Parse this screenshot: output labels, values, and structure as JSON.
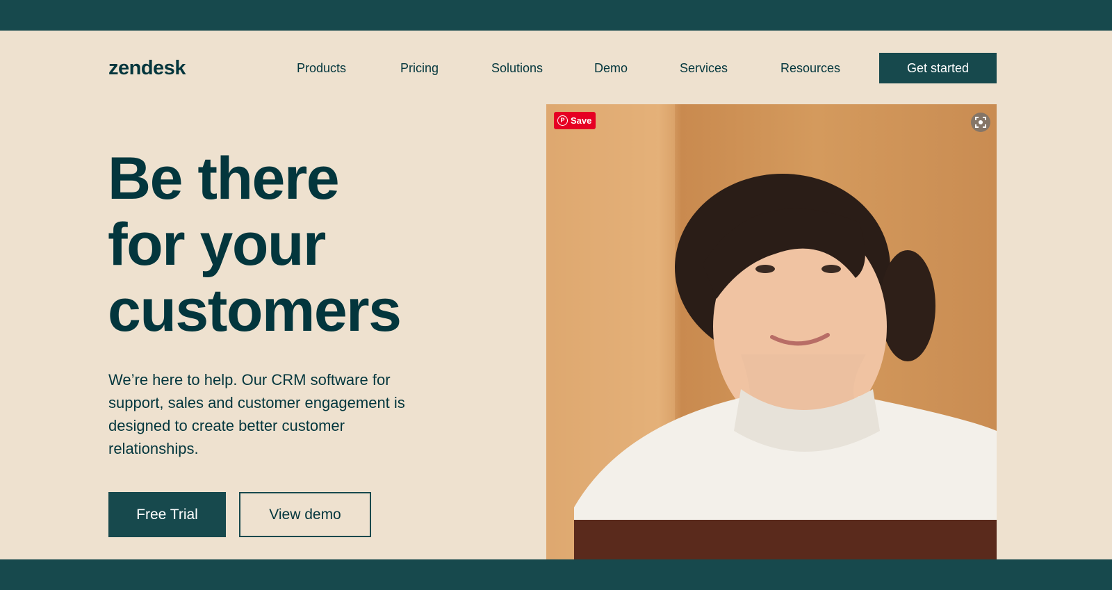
{
  "brand": {
    "logo_text": "zendesk"
  },
  "nav": {
    "items": [
      {
        "label": "Products"
      },
      {
        "label": "Pricing"
      },
      {
        "label": "Solutions"
      },
      {
        "label": "Demo"
      },
      {
        "label": "Services"
      },
      {
        "label": "Resources"
      }
    ],
    "cta_label": "Get started"
  },
  "hero": {
    "headline_lines": [
      "Be there",
      "for your",
      "customers"
    ],
    "body": "We’re here to help. Our CRM software for support, sales and customer engagement is designed to create better customer relationships.",
    "primary_cta": "Free Trial",
    "secondary_cta": "View demo"
  },
  "image_overlay": {
    "save_label": "Save",
    "save_icon": "pinterest-icon",
    "expand_icon": "expand-icon"
  },
  "colors": {
    "brand_dark": "#17494d",
    "text_dark": "#03363d",
    "background": "#eee1cf",
    "pinterest_red": "#e60023"
  }
}
